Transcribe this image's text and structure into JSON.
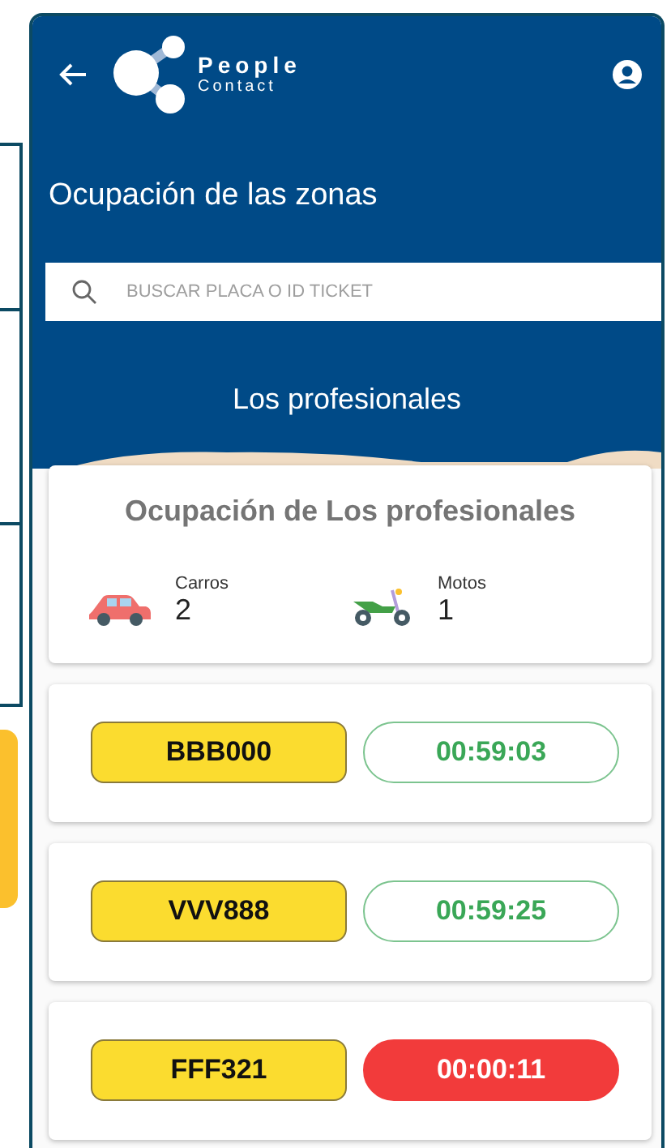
{
  "header": {
    "logo": {
      "line_1": "People",
      "line_2": "Contact"
    },
    "title": "Ocupación de las zonas"
  },
  "search": {
    "placeholder": "BUSCAR PLACA O ID TICKET"
  },
  "zone": {
    "name": "Los profesionales"
  },
  "occupancy": {
    "title": "Ocupación de Los profesionales",
    "counts": [
      {
        "kind": "car",
        "label": "Carros",
        "value": "2"
      },
      {
        "kind": "motorcycle",
        "label": "Motos",
        "value": "1"
      }
    ]
  },
  "tickets": [
    {
      "plate": "BBB000",
      "time": "00:59:03",
      "expired": false
    },
    {
      "plate": "VVV888",
      "time": "00:59:25",
      "expired": false
    },
    {
      "plate": "FFF321",
      "time": "00:00:11",
      "expired": true
    }
  ]
}
